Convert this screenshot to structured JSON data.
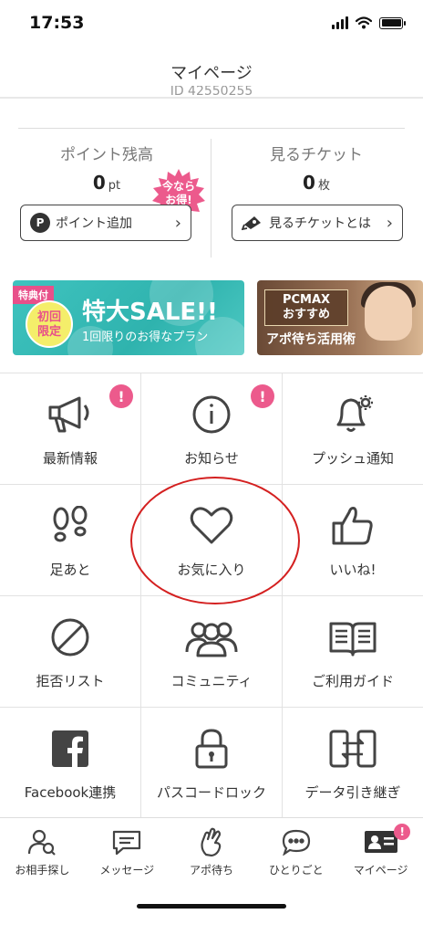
{
  "status_bar": {
    "time": "17:53"
  },
  "header": {
    "title": "マイページ",
    "user_id_partial": "ID 42550255"
  },
  "wallet": {
    "points": {
      "label": "ポイント残高",
      "value": "0",
      "unit": "pt",
      "button": "ポイント追加",
      "button_icon": "P"
    },
    "promo_badge": "今なら\nお得!",
    "tickets": {
      "label": "見るチケット",
      "value": "0",
      "unit": "枚",
      "button": "見るチケットとは"
    }
  },
  "banners": {
    "sale": {
      "tag": "特典付",
      "circle": "初回\n限定",
      "title": "特大SALE!!",
      "subtitle": "1回限りのお得なプラン"
    },
    "pcmax": {
      "box": "PCMAX\nおすすめ",
      "subtitle": "アポ待ち活用術"
    }
  },
  "menu": [
    {
      "label": "最新情報",
      "icon": "megaphone-icon",
      "badge": "!"
    },
    {
      "label": "お知らせ",
      "icon": "info-icon",
      "badge": "!"
    },
    {
      "label": "プッシュ通知",
      "icon": "bell-gear-icon",
      "badge": ""
    },
    {
      "label": "足あと",
      "icon": "footprints-icon",
      "badge": ""
    },
    {
      "label": "お気に入り",
      "icon": "heart-icon",
      "badge": ""
    },
    {
      "label": "いいね!",
      "icon": "thumbs-up-icon",
      "badge": ""
    },
    {
      "label": "拒否リスト",
      "icon": "block-icon",
      "badge": ""
    },
    {
      "label": "コミュニティ",
      "icon": "community-icon",
      "badge": ""
    },
    {
      "label": "ご利用ガイド",
      "icon": "book-icon",
      "badge": ""
    },
    {
      "label": "Facebook連携",
      "icon": "facebook-icon",
      "badge": ""
    },
    {
      "label": "パスコードロック",
      "icon": "lock-icon",
      "badge": ""
    },
    {
      "label": "データ引き継ぎ",
      "icon": "data-transfer-icon",
      "badge": ""
    }
  ],
  "bottom_nav": [
    {
      "label": "お相手探し",
      "icon": "search-person-icon"
    },
    {
      "label": "メッセージ",
      "icon": "message-icon"
    },
    {
      "label": "アポ待ち",
      "icon": "hand-wave-icon"
    },
    {
      "label": "ひとりごと",
      "icon": "speech-bubble-icon"
    },
    {
      "label": "マイページ",
      "icon": "id-card-icon",
      "badge": "!"
    }
  ],
  "colors": {
    "accent_pink": "#ec5a8c",
    "teal": "#3fc3bf",
    "highlight_red": "#d42020"
  }
}
